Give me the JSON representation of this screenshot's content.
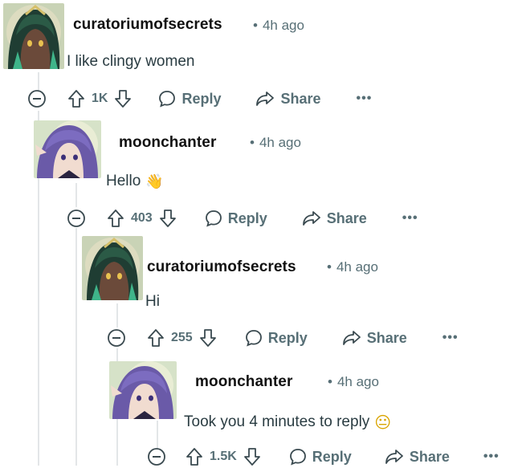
{
  "comments": [
    {
      "username": "curatoriumofsecrets",
      "dot": "•",
      "time": "4h ago",
      "text": "I like clingy women",
      "emoji": "",
      "votes": "1K",
      "reply_label": "Reply",
      "share_label": "Share",
      "more_label": "•••",
      "avatar": "avatar-green-haired-character"
    },
    {
      "username": "moonchanter",
      "dot": "•",
      "time": "4h ago",
      "text": "Hello",
      "emoji": "👋",
      "votes": "403",
      "reply_label": "Reply",
      "share_label": "Share",
      "more_label": "•••",
      "avatar": "avatar-purple-haired-character"
    },
    {
      "username": "curatoriumofsecrets",
      "dot": "•",
      "time": "4h ago",
      "text": "Hi",
      "emoji": "",
      "votes": "255",
      "reply_label": "Reply",
      "share_label": "Share",
      "more_label": "•••",
      "avatar": "avatar-green-haired-character"
    },
    {
      "username": "moonchanter",
      "dot": "•",
      "time": "4h ago",
      "text": "Took you 4 minutes to reply",
      "emoji": "😐",
      "votes": "1.5K",
      "reply_label": "Reply",
      "share_label": "Share",
      "more_label": "•••",
      "avatar": "avatar-purple-haired-character"
    }
  ],
  "colors": {
    "meta": "#576f76",
    "thread_line": "#e3e6e8",
    "username": "#111111"
  }
}
